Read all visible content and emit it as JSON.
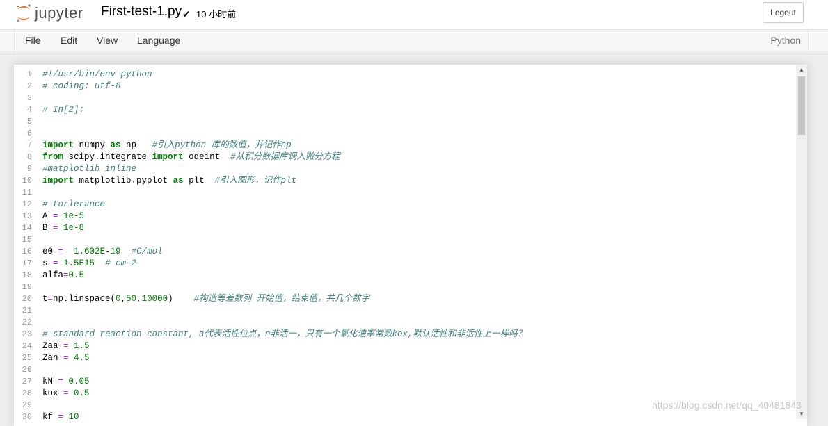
{
  "header": {
    "logo_text": "jupyter",
    "filename": "First-test-1.py",
    "saved_check": "✔",
    "saved_time": "10 小时前",
    "logout_label": "Logout"
  },
  "menubar": {
    "items": [
      "File",
      "Edit",
      "View",
      "Language"
    ],
    "kernel": "Python"
  },
  "editor": {
    "lines": [
      [
        {
          "t": "#!/usr/bin/env python",
          "c": "cm"
        }
      ],
      [
        {
          "t": "# coding: utf-8",
          "c": "cm"
        }
      ],
      [],
      [
        {
          "t": "# In[2]:",
          "c": "cm"
        }
      ],
      [],
      [],
      [
        {
          "t": "import",
          "c": "kw"
        },
        {
          "t": " numpy "
        },
        {
          "t": "as",
          "c": "kw"
        },
        {
          "t": " np   "
        },
        {
          "t": "#引入python 库的数值，并记作np",
          "c": "cm"
        }
      ],
      [
        {
          "t": "from",
          "c": "kw"
        },
        {
          "t": " scipy.integrate "
        },
        {
          "t": "import",
          "c": "kw"
        },
        {
          "t": " odeint  "
        },
        {
          "t": "#从积分数据库调入微分方程",
          "c": "cm"
        }
      ],
      [
        {
          "t": "#matplotlib inline",
          "c": "cm"
        }
      ],
      [
        {
          "t": "import",
          "c": "kw"
        },
        {
          "t": " matplotlib.pyplot "
        },
        {
          "t": "as",
          "c": "kw"
        },
        {
          "t": " plt  "
        },
        {
          "t": "#引入图形，记作plt",
          "c": "cm"
        }
      ],
      [],
      [
        {
          "t": "# torlerance",
          "c": "cm"
        }
      ],
      [
        {
          "t": "A "
        },
        {
          "t": "=",
          "c": "op"
        },
        {
          "t": " 1e-5",
          "c": "nm"
        }
      ],
      [
        {
          "t": "B "
        },
        {
          "t": "=",
          "c": "op"
        },
        {
          "t": " 1e-8",
          "c": "nm"
        }
      ],
      [],
      [
        {
          "t": "e0 "
        },
        {
          "t": "=",
          "c": "op"
        },
        {
          "t": "  1.602E-19",
          "c": "nm"
        },
        {
          "t": "  "
        },
        {
          "t": "#C/mol",
          "c": "cm"
        }
      ],
      [
        {
          "t": "s "
        },
        {
          "t": "=",
          "c": "op"
        },
        {
          "t": " 1.5E15",
          "c": "nm"
        },
        {
          "t": "  "
        },
        {
          "t": "# cm-2",
          "c": "cm"
        }
      ],
      [
        {
          "t": "alfa"
        },
        {
          "t": "=",
          "c": "op"
        },
        {
          "t": "0.5",
          "c": "nm"
        }
      ],
      [],
      [
        {
          "t": "t"
        },
        {
          "t": "=",
          "c": "op"
        },
        {
          "t": "np.linspace("
        },
        {
          "t": "0",
          "c": "nm"
        },
        {
          "t": ","
        },
        {
          "t": "50",
          "c": "nm"
        },
        {
          "t": ","
        },
        {
          "t": "10000",
          "c": "nm"
        },
        {
          "t": ")    "
        },
        {
          "t": "#构造等差数列 开始值，结束值，共几个数字",
          "c": "cm"
        }
      ],
      [],
      [],
      [
        {
          "t": "# standard reaction constant, a代表活性位点，n非活一，只有一个氧化速率常数kox,默认活性和非活性上一样吗？",
          "c": "cm"
        }
      ],
      [
        {
          "t": "Zaa "
        },
        {
          "t": "=",
          "c": "op"
        },
        {
          "t": " 1.5",
          "c": "nm"
        }
      ],
      [
        {
          "t": "Zan "
        },
        {
          "t": "=",
          "c": "op"
        },
        {
          "t": " 4.5",
          "c": "nm"
        }
      ],
      [],
      [
        {
          "t": "kN "
        },
        {
          "t": "=",
          "c": "op"
        },
        {
          "t": " 0.05",
          "c": "nm"
        }
      ],
      [
        {
          "t": "kox "
        },
        {
          "t": "=",
          "c": "op"
        },
        {
          "t": " 0.5",
          "c": "nm"
        }
      ],
      [],
      [
        {
          "t": "kf "
        },
        {
          "t": "=",
          "c": "op"
        },
        {
          "t": " 10",
          "c": "nm"
        }
      ]
    ]
  },
  "watermark": "https://blog.csdn.net/qq_40481843"
}
